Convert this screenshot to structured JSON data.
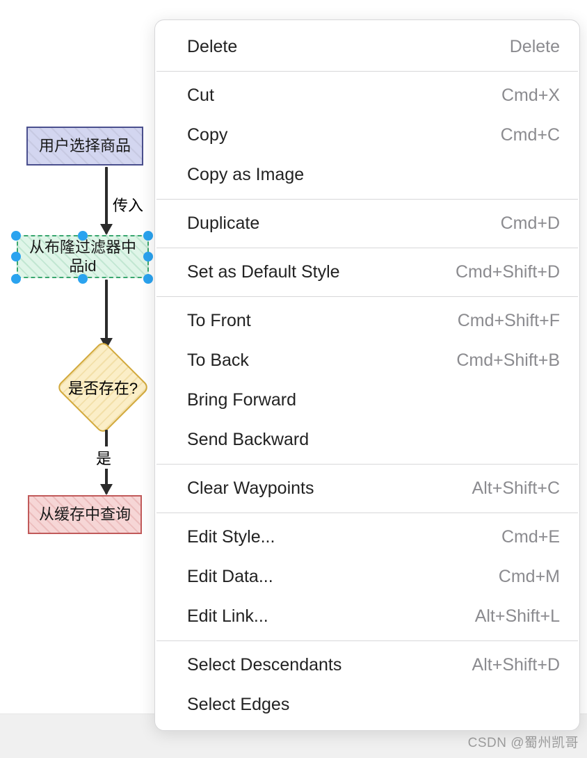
{
  "flowchart": {
    "nodes": {
      "n1": "用户选择商品",
      "n2": "从布隆过滤器中\n品id",
      "n3": "是否存在?",
      "n4": "从缓存中查询"
    },
    "edgeLabels": {
      "e1": "传入",
      "e2": "是"
    }
  },
  "menu": {
    "groups": [
      [
        {
          "label": "Delete",
          "shortcut": "Delete"
        }
      ],
      [
        {
          "label": "Cut",
          "shortcut": "Cmd+X"
        },
        {
          "label": "Copy",
          "shortcut": "Cmd+C"
        },
        {
          "label": "Copy as Image",
          "shortcut": ""
        }
      ],
      [
        {
          "label": "Duplicate",
          "shortcut": "Cmd+D"
        }
      ],
      [
        {
          "label": "Set as Default Style",
          "shortcut": "Cmd+Shift+D"
        }
      ],
      [
        {
          "label": "To Front",
          "shortcut": "Cmd+Shift+F"
        },
        {
          "label": "To Back",
          "shortcut": "Cmd+Shift+B"
        },
        {
          "label": "Bring Forward",
          "shortcut": ""
        },
        {
          "label": "Send Backward",
          "shortcut": ""
        }
      ],
      [
        {
          "label": "Clear Waypoints",
          "shortcut": "Alt+Shift+C"
        }
      ],
      [
        {
          "label": "Edit Style...",
          "shortcut": "Cmd+E"
        },
        {
          "label": "Edit Data...",
          "shortcut": "Cmd+M"
        },
        {
          "label": "Edit Link...",
          "shortcut": "Alt+Shift+L"
        }
      ],
      [
        {
          "label": "Select Descendants",
          "shortcut": "Alt+Shift+D"
        },
        {
          "label": "Select Edges",
          "shortcut": ""
        }
      ]
    ]
  },
  "watermark": "CSDN @蜀州凯哥"
}
